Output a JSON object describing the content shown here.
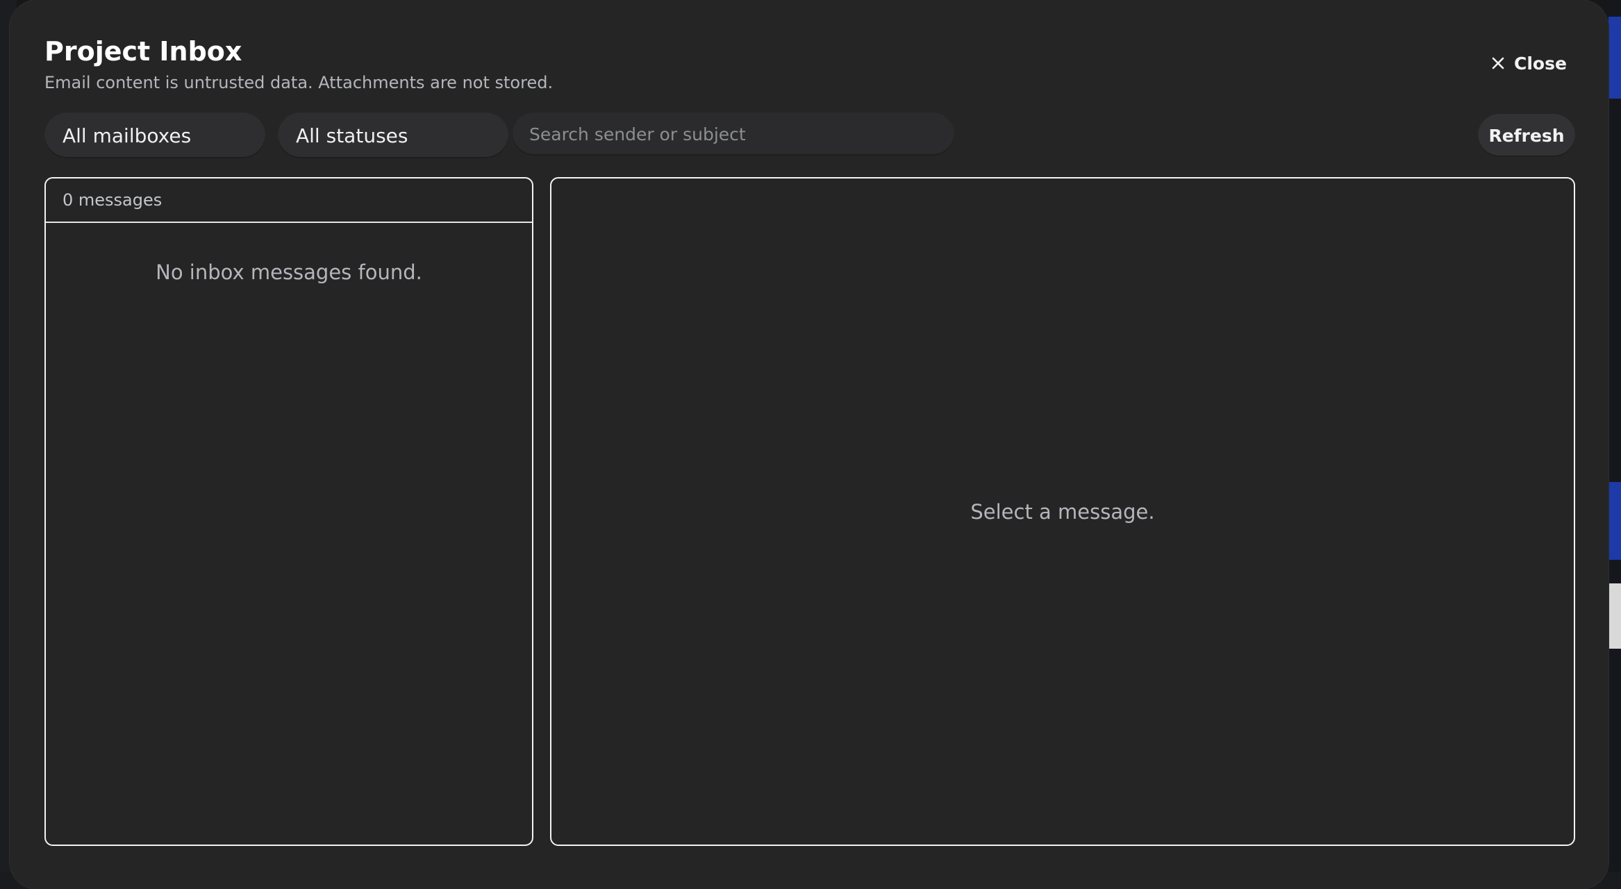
{
  "modal": {
    "title": "Project Inbox",
    "subtitle": "Email content is untrusted data. Attachments are not stored.",
    "close_label": "Close"
  },
  "filters": {
    "mailbox_selected": "All mailboxes",
    "status_selected": "All statuses",
    "search_placeholder": "Search sender or subject",
    "refresh_label": "Refresh"
  },
  "list": {
    "count_label": "0 messages",
    "empty_text": "No inbox messages found."
  },
  "detail": {
    "empty_text": "Select a message."
  },
  "icons": {
    "close": "close-icon"
  },
  "colors": {
    "modal_bg": "#252526",
    "panel_border": "#f3f3f3",
    "control_bg": "#2e2e30"
  }
}
